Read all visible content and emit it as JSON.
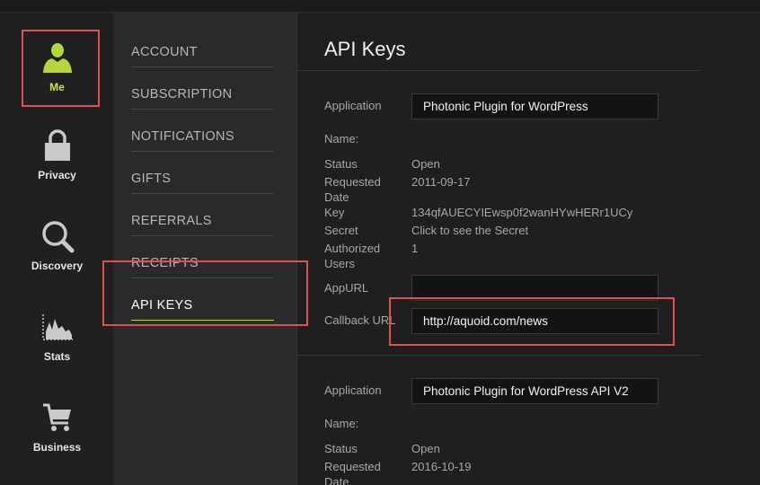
{
  "sidebar": {
    "items": [
      {
        "label": "Me",
        "icon": "user-icon"
      },
      {
        "label": "Privacy",
        "icon": "lock-icon"
      },
      {
        "label": "Discovery",
        "icon": "search-icon"
      },
      {
        "label": "Stats",
        "icon": "chart-icon"
      },
      {
        "label": "Business",
        "icon": "cart-icon"
      }
    ]
  },
  "submenu": {
    "items": [
      "ACCOUNT",
      "SUBSCRIPTION",
      "NOTIFICATIONS",
      "GIFTS",
      "REFERRALS",
      "RECEIPTS",
      "API KEYS"
    ]
  },
  "main": {
    "title": "API Keys",
    "apps": [
      {
        "application_label": "Application",
        "name_label": "Name:",
        "application_value": "Photonic Plugin for WordPress",
        "status_label": "Status",
        "status_value": "Open",
        "requested_label_1": "Requested",
        "requested_label_2": "Date",
        "requested_value": "2011-09-17",
        "key_label": "Key",
        "key_value": "134qfAUECYIEwsp0f2wanHYwHERr1UCy",
        "secret_label": "Secret",
        "secret_value": "Click to see the Secret",
        "authorized_label_1": "Authorized",
        "authorized_label_2": "Users",
        "authorized_value": "1",
        "appurl_label": "AppURL",
        "appurl_value": "",
        "callback_label": "Callback URL",
        "callback_value": "http://aquoid.com/news"
      },
      {
        "application_label": "Application",
        "name_label": "Name:",
        "application_value": "Photonic Plugin for WordPress API V2",
        "status_label": "Status",
        "status_value": "Open",
        "requested_label_1": "Requested",
        "requested_label_2": "Date",
        "requested_value": "2016-10-19"
      }
    ]
  },
  "colors": {
    "accent": "#b6d63e",
    "highlight": "#d9534f",
    "background": "#1f1f21"
  }
}
